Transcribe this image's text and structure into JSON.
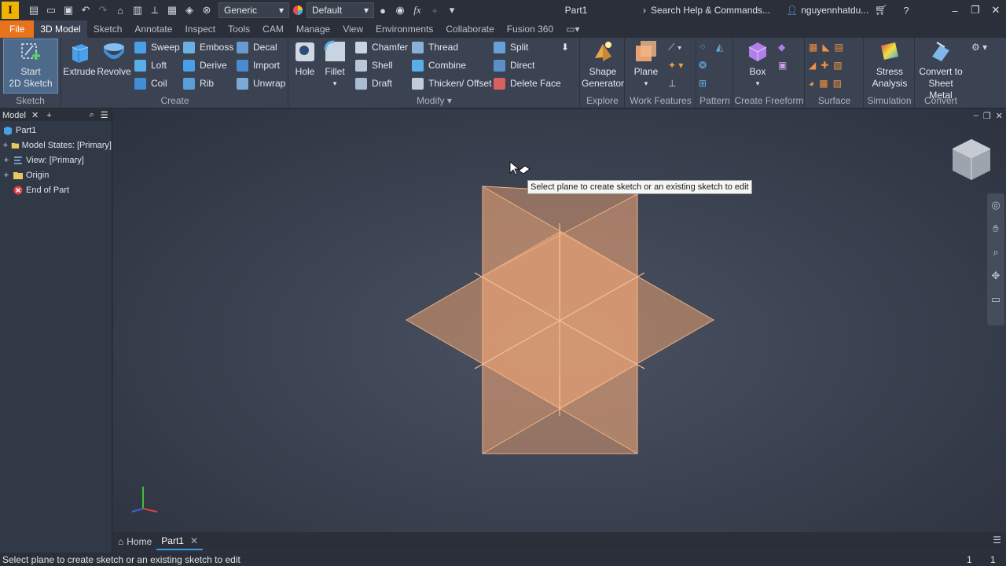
{
  "titlebar": {
    "appearance_select": "Generic",
    "material_select": "Default",
    "fx_label": "fx",
    "doc_title": "Part1",
    "search_placeholder": "Search Help & Commands...",
    "user_name": "nguyennhatdu..."
  },
  "tabs": [
    "File",
    "3D Model",
    "Sketch",
    "Annotate",
    "Inspect",
    "Tools",
    "CAM",
    "Manage",
    "View",
    "Environments",
    "Collaborate",
    "Fusion 360"
  ],
  "ribbon": {
    "sketch": {
      "title": "Sketch",
      "start_sketch": "Start\n2D Sketch"
    },
    "create": {
      "title": "Create",
      "extrude": "Extrude",
      "revolve": "Revolve",
      "sweep": "Sweep",
      "loft": "Loft",
      "coil": "Coil",
      "emboss": "Emboss",
      "derive": "Derive",
      "rib": "Rib",
      "decal": "Decal",
      "import": "Import",
      "unwrap": "Unwrap"
    },
    "modify": {
      "title": "Modify",
      "hole": "Hole",
      "fillet": "Fillet",
      "chamfer": "Chamfer",
      "shell": "Shell",
      "draft": "Draft",
      "thread": "Thread",
      "combine": "Combine",
      "thicken": "Thicken/ Offset",
      "split": "Split",
      "direct": "Direct",
      "delete_face": "Delete Face"
    },
    "explore": {
      "title": "Explore",
      "shape_generator": "Shape\nGenerator"
    },
    "work_features": {
      "title": "Work Features",
      "plane": "Plane"
    },
    "pattern": {
      "title": "Pattern"
    },
    "freeform": {
      "title": "Create Freeform",
      "box": "Box"
    },
    "surface": {
      "title": "Surface"
    },
    "simulation": {
      "title": "Simulation",
      "stress": "Stress\nAnalysis"
    },
    "convert": {
      "title": "Convert",
      "sheet_metal": "Convert to\nSheet Metal"
    }
  },
  "browser": {
    "tab": "Model",
    "items": [
      {
        "label": "Part1"
      },
      {
        "label": "Model States: [Primary]"
      },
      {
        "label": "View: [Primary]"
      },
      {
        "label": "Origin"
      },
      {
        "label": "End of Part"
      }
    ]
  },
  "viewport": {
    "tooltip": "Select plane to create sketch or an existing sketch to edit"
  },
  "doc_tabs": {
    "home": "Home",
    "part": "Part1"
  },
  "status": {
    "message": "Select plane to create sketch or an existing sketch to edit",
    "count1": "1",
    "count2": "1"
  },
  "colors": {
    "file_tab": "#e8731c",
    "plane_fill": "#e8a070",
    "plane_edge": "#f0b080",
    "accent": "#3a9be8"
  }
}
